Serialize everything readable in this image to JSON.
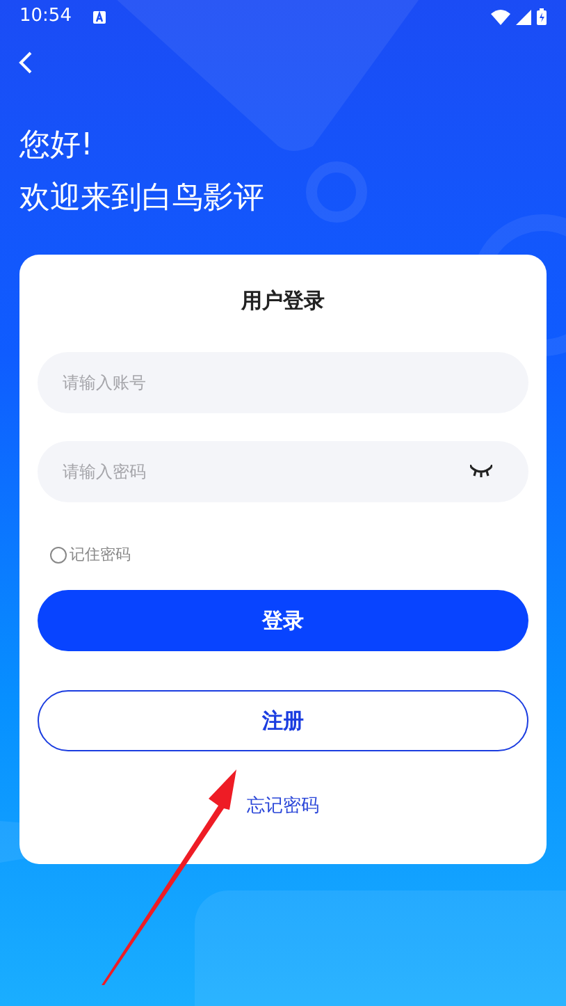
{
  "status_bar": {
    "time": "10:54"
  },
  "greeting": [
    "您好!",
    "欢迎来到白鸟影评"
  ],
  "login_card": {
    "title": "用户登录",
    "fields": [
      {
        "kind": "text",
        "placeholder": "请输入账号"
      },
      {
        "kind": "password",
        "placeholder": "请输入密码"
      }
    ],
    "remember": {
      "label": "记住密码",
      "checked": false
    },
    "buttons": [
      {
        "kind": "primary",
        "label": "登录"
      },
      {
        "kind": "outline",
        "label": "注册"
      }
    ],
    "forgot_link": "忘记密码"
  }
}
